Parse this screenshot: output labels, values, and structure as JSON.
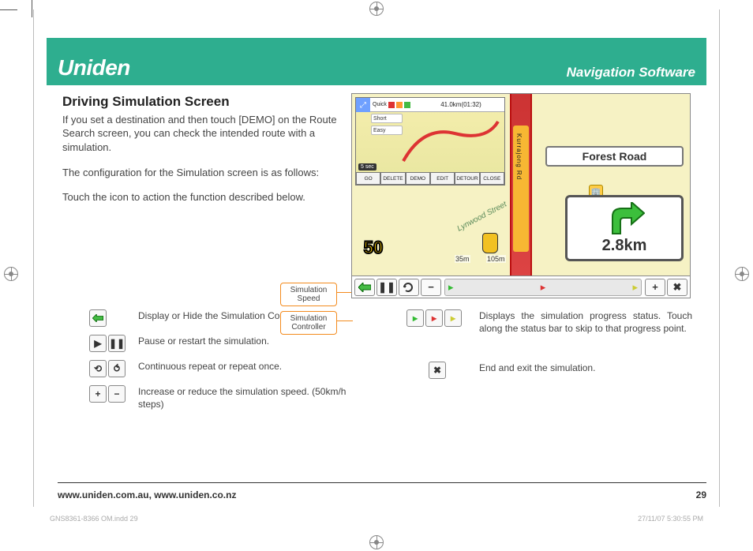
{
  "header": {
    "logo": "Uniden",
    "title": "Navigation Software"
  },
  "section": {
    "heading": "Driving Simulation Screen",
    "para1": "If you set a destination and then touch [DEMO] on the Route Search screen, you can check the intended route with a simulation.",
    "para2": "The configuration for the Simulation screen is as follows:",
    "para3": "Touch the icon to action the function described below."
  },
  "callouts": {
    "speed": "Simulation\nSpeed",
    "controller": "Simulation\nController"
  },
  "device": {
    "minimap": {
      "quick_label": "Quick",
      "distance": "41.0km(01:32)",
      "short_label": "Short",
      "easy_label": "Easy",
      "fivesec": "5 sec",
      "tabs": [
        "GO",
        "DELETE",
        "DEMO",
        "EDIT",
        "DETOUR",
        "CLOSE"
      ]
    },
    "road_name": "Forest Road",
    "lynwood": "Lynwood Street",
    "vertical_road": "Kurrajong Rd",
    "speed": "50",
    "scale_near": "35m",
    "scale_far": "105m",
    "turn_distance": "2.8km",
    "simbar": {
      "show_hide": "⬅",
      "pause": "❚❚",
      "repeat": "⟲",
      "minus": "−",
      "plus": "+",
      "close": "✖",
      "flag1": "🚩",
      "flag2": "🚩",
      "flag3": "🚩"
    }
  },
  "legend": {
    "left": [
      {
        "text": "Display or Hide the Simulation Controls."
      },
      {
        "text": "Pause or restart the simulation."
      },
      {
        "text": "Continuous repeat or repeat once."
      },
      {
        "text": "Increase or reduce the simulation speed. (50km/h steps)"
      }
    ],
    "right_flags": "Displays the simulation progress status. Touch along the status bar to skip to that progress point.",
    "right_close": "End and exit the simulation."
  },
  "footer": {
    "urls": "www.uniden.com.au, www.uniden.co.nz",
    "page": "29"
  },
  "imprint": {
    "left": "GNS8361-8366 OM.indd   29",
    "right": "27/11/07   5:30:55 PM"
  }
}
